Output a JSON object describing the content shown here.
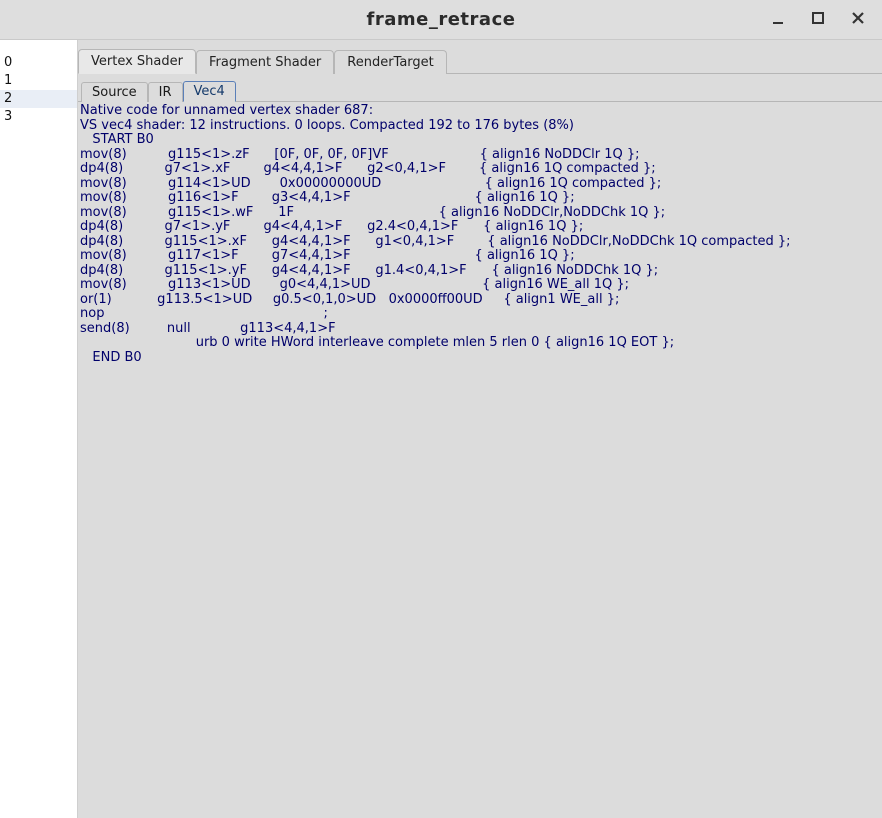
{
  "window": {
    "title": "frame_retrace"
  },
  "gutter": {
    "items": [
      "0",
      "1",
      "2",
      "3"
    ],
    "selected_index": 2
  },
  "tabs": {
    "items": [
      {
        "label": "Vertex Shader"
      },
      {
        "label": "Fragment Shader"
      },
      {
        "label": "RenderTarget"
      }
    ],
    "active_index": 0
  },
  "subtabs": {
    "items": [
      {
        "label": "Source"
      },
      {
        "label": "IR"
      },
      {
        "label": "Vec4"
      }
    ],
    "active_index": 2
  },
  "code": "Native code for unnamed vertex shader 687:\nVS vec4 shader: 12 instructions. 0 loops. Compacted 192 to 176 bytes (8%)\n   START B0\nmov(8)          g115<1>.zF      [0F, 0F, 0F, 0F]VF                      { align16 NoDDClr 1Q };\ndp4(8)          g7<1>.xF        g4<4,4,1>F      g2<0,4,1>F        { align16 1Q compacted };\nmov(8)          g114<1>UD       0x00000000UD                         { align16 1Q compacted };\nmov(8)          g116<1>F        g3<4,4,1>F                              { align16 1Q };\nmov(8)          g115<1>.wF      1F                                   { align16 NoDDClr,NoDDChk 1Q };\ndp4(8)          g7<1>.yF        g4<4,4,1>F      g2.4<0,4,1>F      { align16 1Q };\ndp4(8)          g115<1>.xF      g4<4,4,1>F      g1<0,4,1>F        { align16 NoDDClr,NoDDChk 1Q compacted };\nmov(8)          g117<1>F        g7<4,4,1>F                              { align16 1Q };\ndp4(8)          g115<1>.yF      g4<4,4,1>F      g1.4<0,4,1>F      { align16 NoDDChk 1Q };\nmov(8)          g113<1>UD       g0<4,4,1>UD                           { align16 WE_all 1Q };\nor(1)           g113.5<1>UD     g0.5<0,1,0>UD   0x0000ff00UD     { align1 WE_all };\nnop                                                     ;\nsend(8)         null            g113<4,4,1>F\n                            urb 0 write HWord interleave complete mlen 5 rlen 0 { align16 1Q EOT };\n   END B0"
}
